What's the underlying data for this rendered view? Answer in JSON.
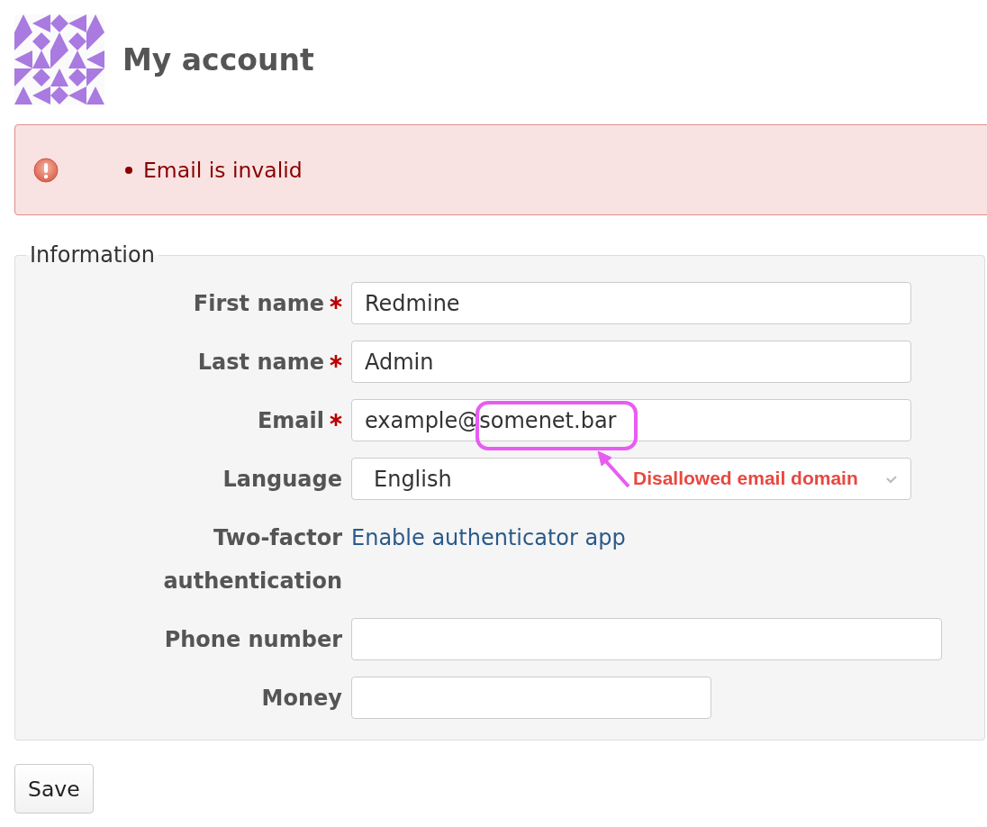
{
  "header": {
    "title": "My account"
  },
  "flash": {
    "kind": "error",
    "messages": [
      "Email is invalid"
    ]
  },
  "form": {
    "legend": "Information",
    "fields": [
      {
        "label": "First name",
        "required": true,
        "kind": "text",
        "value": "Redmine"
      },
      {
        "label": "Last name",
        "required": true,
        "kind": "text",
        "value": "Admin"
      },
      {
        "label": "Email",
        "required": true,
        "kind": "text",
        "value": "example@somenet.bar"
      },
      {
        "label": "Language",
        "required": false,
        "kind": "select",
        "value": "English"
      },
      {
        "label": "Two-factor authentication",
        "required": false,
        "kind": "link",
        "value": "Enable authenticator app"
      },
      {
        "label": "Phone number",
        "required": false,
        "kind": "long-text"
      },
      {
        "label": "Money",
        "required": false,
        "kind": "short-text"
      }
    ]
  },
  "annotation": {
    "text": "Disallowed email domain"
  },
  "buttons": [
    {
      "label": "Save"
    }
  ]
}
